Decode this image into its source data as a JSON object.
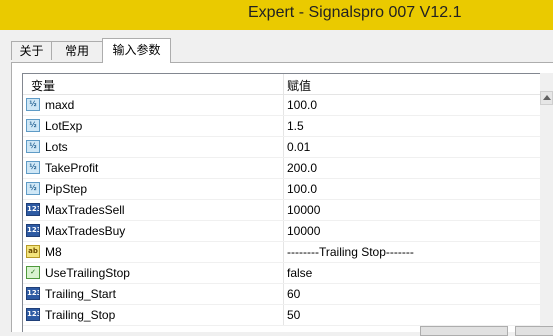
{
  "window": {
    "title": "Expert - Signalspro 007 V12.1"
  },
  "tabs": [
    {
      "label": "关于"
    },
    {
      "label": "常用"
    },
    {
      "label": "输入参数"
    }
  ],
  "grid": {
    "headers": {
      "variable": "变量",
      "value": "赋值"
    },
    "rows": [
      {
        "icon": "fraction-icon",
        "icon_text": "½",
        "name": "maxd",
        "value": "100.0"
      },
      {
        "icon": "fraction-icon",
        "icon_text": "½",
        "name": "LotExp",
        "value": "1.5"
      },
      {
        "icon": "fraction-icon",
        "icon_text": "½",
        "name": "Lots",
        "value": "0.01"
      },
      {
        "icon": "fraction-icon",
        "icon_text": "½",
        "name": "TakeProfit",
        "value": "200.0"
      },
      {
        "icon": "fraction-icon",
        "icon_text": "½",
        "name": "PipStep",
        "value": "100.0"
      },
      {
        "icon": "integer-icon",
        "icon_text": "123",
        "name": "MaxTradesSell",
        "value": "10000"
      },
      {
        "icon": "integer-icon",
        "icon_text": "123",
        "name": "MaxTradesBuy",
        "value": "10000"
      },
      {
        "icon": "string-icon",
        "icon_text": "ab",
        "name": "M8",
        "value": "--------Trailing Stop-------"
      },
      {
        "icon": "boolean-icon",
        "icon_text": "✓",
        "name": "UseTrailingStop",
        "value": "false"
      },
      {
        "icon": "integer-icon",
        "icon_text": "123",
        "name": "Trailing_Start",
        "value": "60"
      },
      {
        "icon": "integer-icon",
        "icon_text": "123",
        "name": "Trailing_Stop",
        "value": "50"
      }
    ]
  }
}
